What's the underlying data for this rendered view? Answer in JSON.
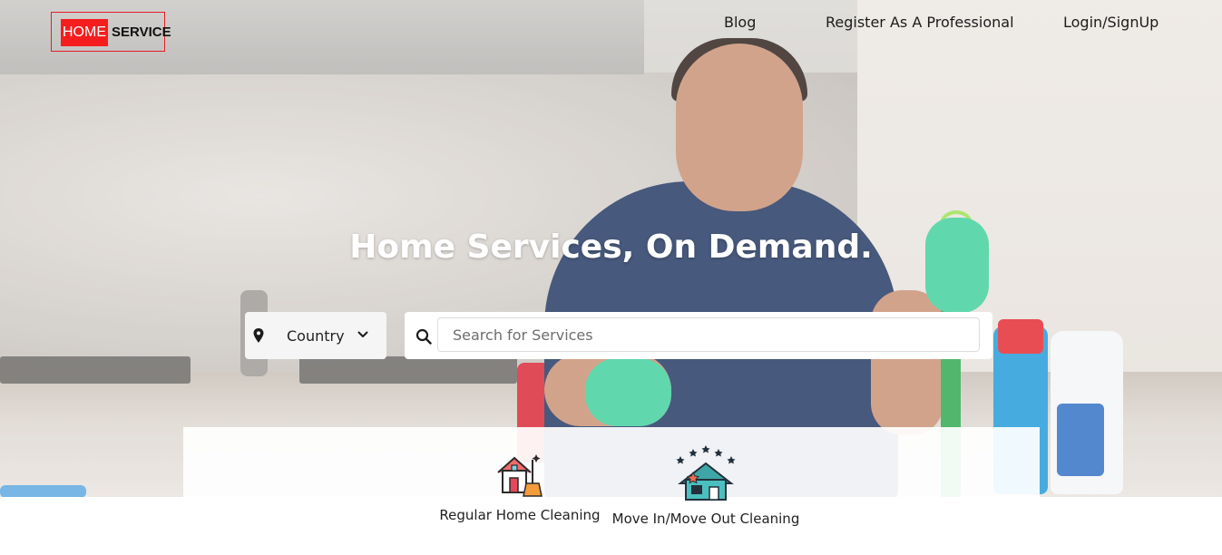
{
  "brand": {
    "logo_part1": "HOME",
    "logo_part2": "SERVICE",
    "accent_color": "#f51d1d"
  },
  "nav": {
    "links": [
      "Blog",
      "Register As A Professional",
      "Login/SignUp"
    ]
  },
  "hero": {
    "headline": "Home Services, On Demand."
  },
  "search": {
    "country_label": "Country",
    "placeholder": "Search for Services",
    "value": "",
    "location_icon": "map-pin-icon",
    "dropdown_icon": "chevron-down-icon",
    "search_icon": "search-icon"
  },
  "services": [
    {
      "label": "Regular Home Cleaning",
      "icon": "house-broom-icon"
    },
    {
      "label": "Move In/Move Out Cleaning",
      "icon": "house-stars-icon"
    }
  ]
}
